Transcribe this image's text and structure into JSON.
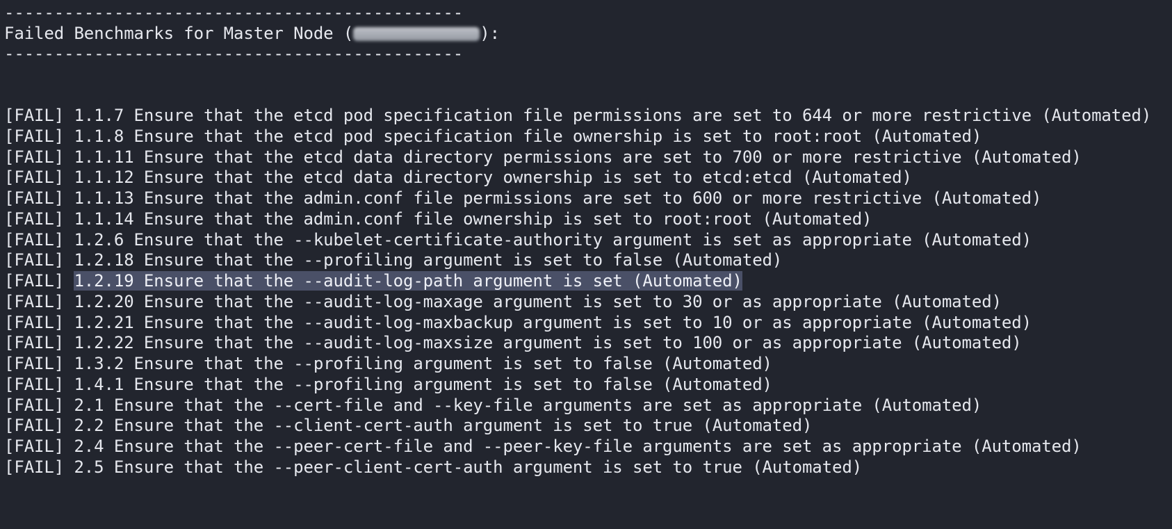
{
  "terminal": {
    "divider_top": "----------------------------------------------",
    "header_prefix": "Failed Benchmarks for Master Node (",
    "header_suffix": "):",
    "divider_bottom": "----------------------------------------------",
    "fail_tag": "[FAIL] ",
    "results": [
      {
        "text": "1.1.7 Ensure that the etcd pod specification file permissions are set to 644 or more restrictive (Automated)"
      },
      {
        "text": "1.1.8 Ensure that the etcd pod specification file ownership is set to root:root (Automated)"
      },
      {
        "text": "1.1.11 Ensure that the etcd data directory permissions are set to 700 or more restrictive (Automated)"
      },
      {
        "text": "1.1.12 Ensure that the etcd data directory ownership is set to etcd:etcd (Automated)"
      },
      {
        "text": "1.1.13 Ensure that the admin.conf file permissions are set to 600 or more restrictive (Automated)"
      },
      {
        "text": "1.1.14 Ensure that the admin.conf file ownership is set to root:root (Automated)"
      },
      {
        "text": "1.2.6 Ensure that the --kubelet-certificate-authority argument is set as appropriate (Automated)"
      },
      {
        "text": "1.2.18 Ensure that the --profiling argument is set to false (Automated)"
      },
      {
        "text": "1.2.19 Ensure that the --audit-log-path argument is set (Automated)",
        "selected": true
      },
      {
        "text": "1.2.20 Ensure that the --audit-log-maxage argument is set to 30 or as appropriate (Automated)"
      },
      {
        "text": "1.2.21 Ensure that the --audit-log-maxbackup argument is set to 10 or as appropriate (Automated)"
      },
      {
        "text": "1.2.22 Ensure that the --audit-log-maxsize argument is set to 100 or as appropriate (Automated)"
      },
      {
        "text": "1.3.2 Ensure that the --profiling argument is set to false (Automated)"
      },
      {
        "text": "1.4.1 Ensure that the --profiling argument is set to false (Automated)"
      },
      {
        "text": "2.1 Ensure that the --cert-file and --key-file arguments are set as appropriate (Automated)"
      },
      {
        "text": "2.2 Ensure that the --client-cert-auth argument is set to true (Automated)"
      },
      {
        "text": "2.4 Ensure that the --peer-cert-file and --peer-key-file arguments are set as appropriate (Automated)"
      },
      {
        "text": "2.5 Ensure that the --peer-client-cert-auth argument is set to true (Automated)"
      }
    ]
  },
  "colors": {
    "background": "#22252e",
    "text": "#e6e8ee",
    "selection": "#4a5067"
  }
}
